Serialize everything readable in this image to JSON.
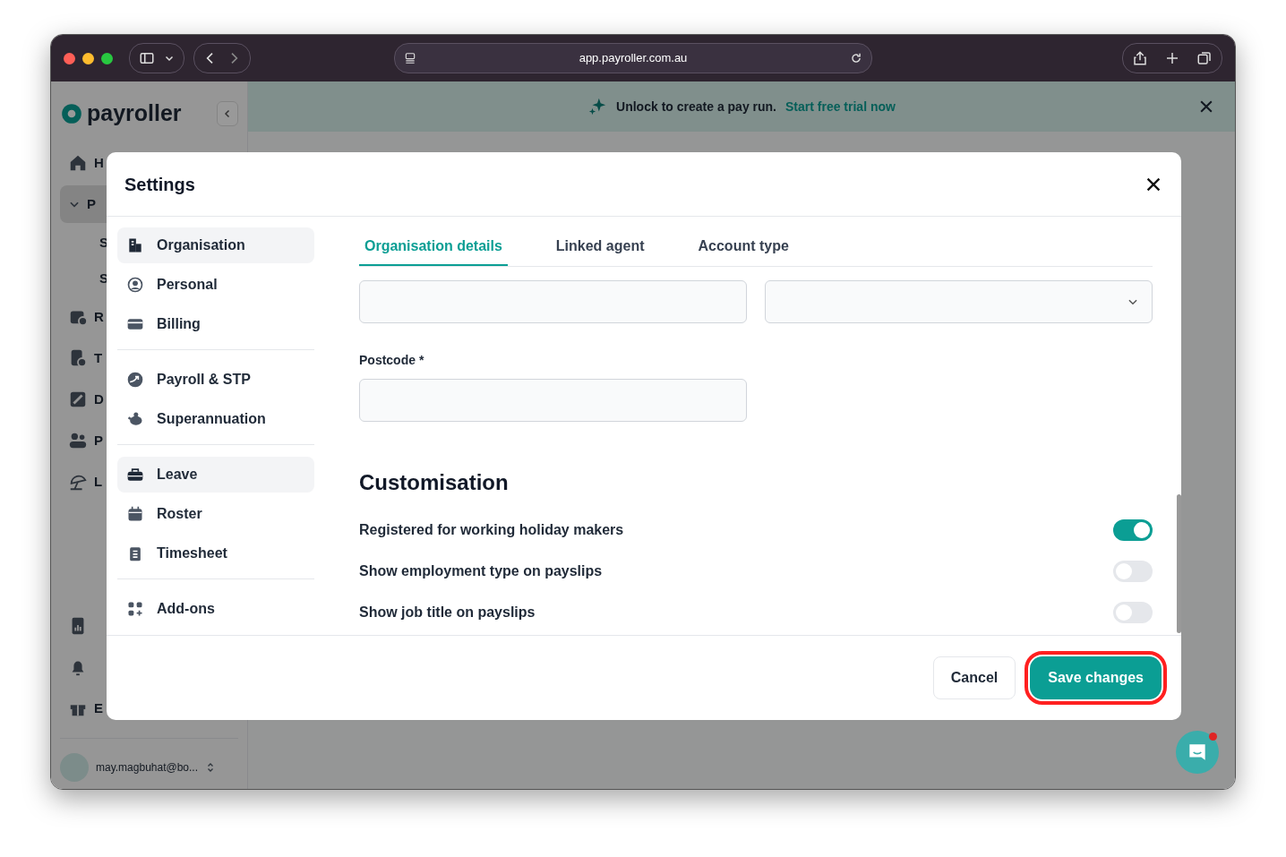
{
  "browser": {
    "url": "app.payroller.com.au"
  },
  "sidebar": {
    "logo": "payroller",
    "items": [
      {
        "label": "H",
        "kind": "link",
        "selected": false
      },
      {
        "label": "P",
        "kind": "group",
        "expanded": true,
        "selected": true,
        "children": [
          {
            "label": "S"
          },
          {
            "label": "S"
          }
        ]
      },
      {
        "label": "R",
        "kind": "link",
        "selected": false
      },
      {
        "label": "T",
        "kind": "link",
        "selected": false
      },
      {
        "label": "D",
        "kind": "link",
        "selected": false
      },
      {
        "label": "P",
        "kind": "link",
        "selected": false
      },
      {
        "label": "L",
        "kind": "link",
        "selected": false
      }
    ],
    "bottom_items": [
      {
        "label": "E"
      }
    ],
    "user": {
      "email": "may.magbuhat@bo..."
    }
  },
  "banner": {
    "text": "Unlock to create a pay run.",
    "link": "Start free trial now"
  },
  "modal": {
    "title": "Settings",
    "nav": [
      [
        {
          "label": "Organisation",
          "highlighted": true
        },
        {
          "label": "Personal",
          "highlighted": false
        },
        {
          "label": "Billing",
          "highlighted": false
        }
      ],
      [
        {
          "label": "Payroll & STP",
          "highlighted": false
        },
        {
          "label": "Superannuation",
          "highlighted": false
        }
      ],
      [
        {
          "label": "Leave",
          "highlighted": true
        },
        {
          "label": "Roster",
          "highlighted": false
        },
        {
          "label": "Timesheet",
          "highlighted": false
        }
      ],
      [
        {
          "label": "Add-ons",
          "highlighted": false
        }
      ]
    ],
    "tabs": [
      {
        "label": "Organisation details",
        "selected": true
      },
      {
        "label": "Linked agent",
        "selected": false
      },
      {
        "label": "Account type",
        "selected": false
      }
    ],
    "fields": [
      {
        "kind": "text"
      },
      {
        "kind": "select"
      },
      {
        "kind": "text",
        "label": "Postcode *"
      }
    ],
    "customisation": {
      "heading": "Customisation",
      "toggles": [
        {
          "label": "Registered for working holiday makers",
          "on": true
        },
        {
          "label": "Show employment type on payslips",
          "on": false
        },
        {
          "label": "Show job title on payslips",
          "on": false
        }
      ]
    },
    "buttons": [
      {
        "label": "Cancel",
        "kind": "secondary",
        "highlighted": false
      },
      {
        "label": "Save changes",
        "kind": "primary",
        "highlighted": true
      }
    ]
  },
  "chat": {
    "unread": true
  }
}
